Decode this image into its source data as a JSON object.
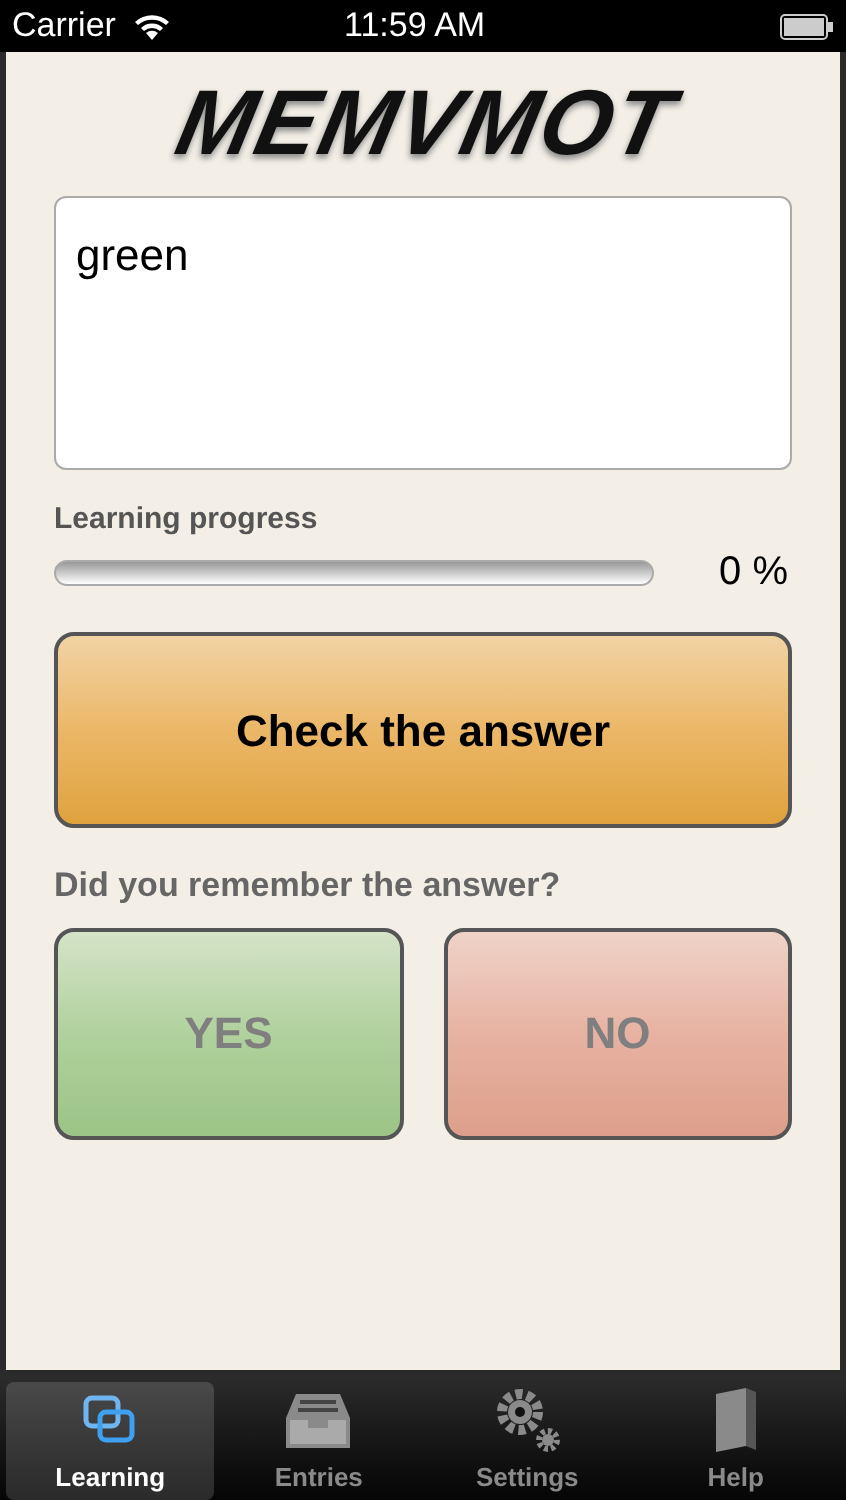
{
  "status_bar": {
    "carrier": "Carrier",
    "time": "11:59 AM"
  },
  "logo": {
    "text": "MEMVMOT"
  },
  "answer_field": {
    "value": "green"
  },
  "progress": {
    "label": "Learning progress",
    "level": 0,
    "reading": "0 %"
  },
  "check_button": {
    "label": "Check the answer"
  },
  "question": "Did you remember the answer?",
  "answer_buttons": [
    {
      "kind": "yes",
      "label": "YES",
      "disabled": true
    },
    {
      "kind": "no",
      "label": "NO",
      "disabled": true
    }
  ],
  "tabs": [
    {
      "kind": "learning",
      "label": "Learning",
      "selected": true
    },
    {
      "kind": "entries",
      "label": "Entries",
      "selected": false
    },
    {
      "kind": "settings",
      "label": "Settings",
      "selected": false
    },
    {
      "kind": "help",
      "label": "Help",
      "selected": false
    }
  ]
}
